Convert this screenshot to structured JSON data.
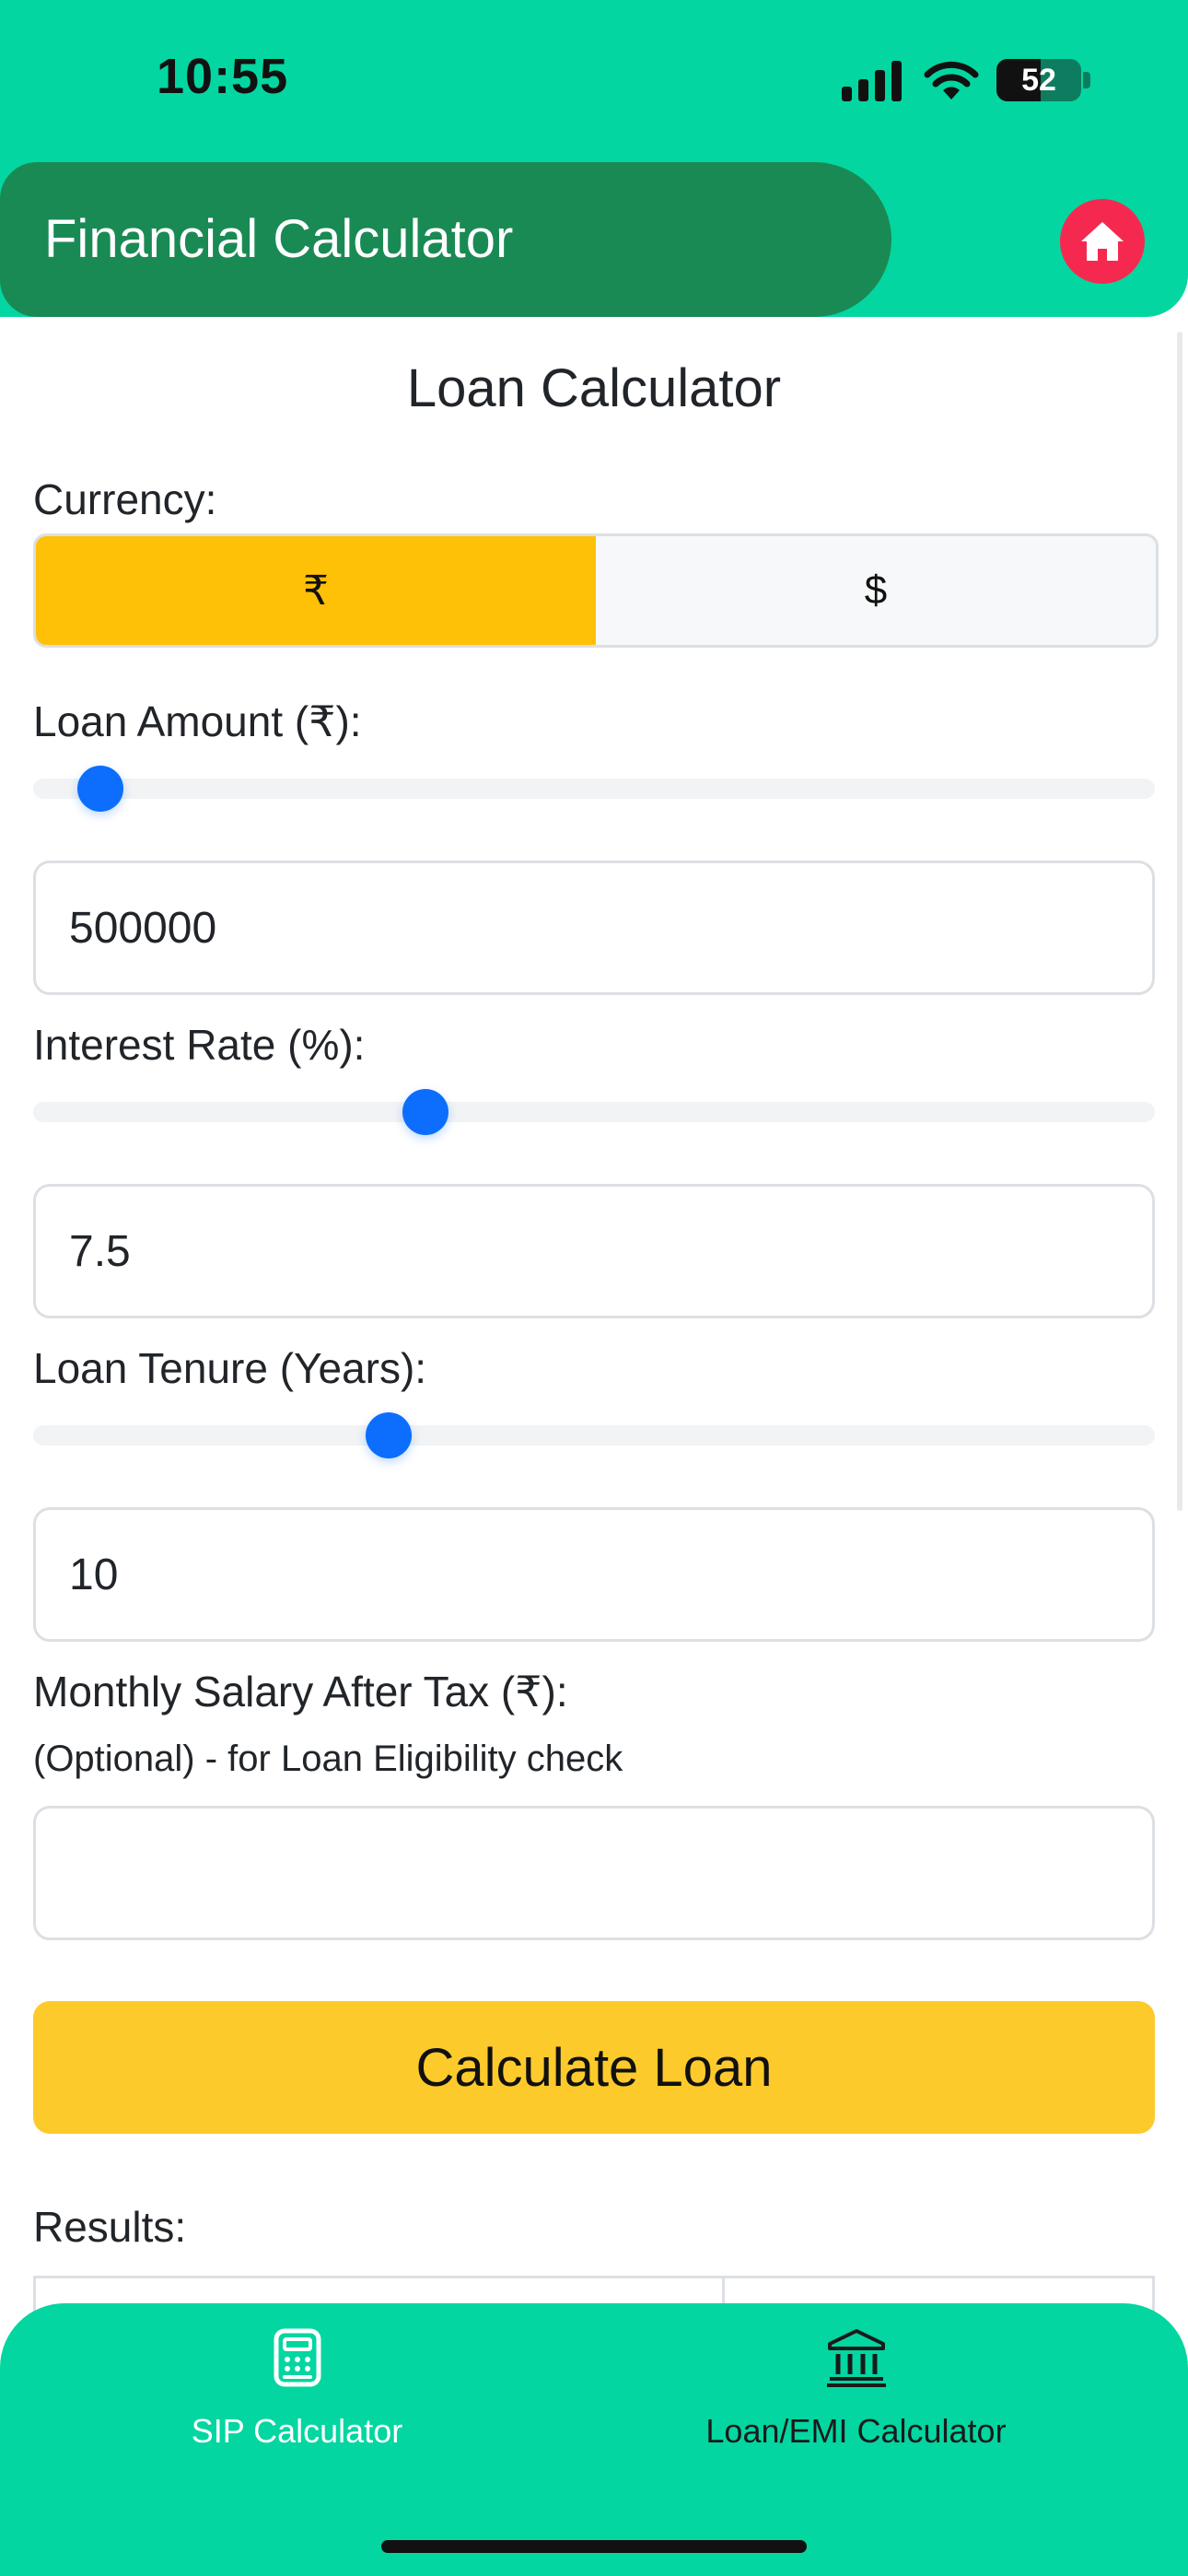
{
  "status_bar": {
    "time": "10:55",
    "battery": "52",
    "battery_level": 0.52
  },
  "header": {
    "title": "Financial Calculator",
    "home_icon": "home-icon"
  },
  "page_title": "Loan Calculator",
  "currency": {
    "label": "Currency:",
    "options": [
      "₹",
      "$"
    ],
    "selected": "₹"
  },
  "loan_amount": {
    "label": "Loan Amount (₹):",
    "value": "500000",
    "slider_fraction": 0.06
  },
  "interest_rate": {
    "label": "Interest Rate (%):",
    "value": "7.5",
    "slider_fraction": 0.35
  },
  "loan_tenure": {
    "label": "Loan Tenure (Years):",
    "value": "10",
    "slider_fraction": 0.317
  },
  "salary": {
    "label": "Monthly Salary After Tax (₹):",
    "hint": "(Optional) - for Loan Eligibility check",
    "value": ""
  },
  "calculate_button": "Calculate Loan",
  "results_label": "Results:",
  "tabs": [
    {
      "label": "SIP Calculator",
      "icon": "calculator-icon",
      "color": "#ffffff"
    },
    {
      "label": "Loan/EMI Calculator",
      "icon": "bank-icon",
      "color": "#1a1a1a"
    }
  ],
  "colors": {
    "accent": "#03d6a1",
    "header_pill": "#1a8a55",
    "home_button": "#f5294f",
    "currency_active": "#ffc107",
    "calculate_button": "#fdca2c",
    "slider_thumb": "#0d6efd"
  }
}
